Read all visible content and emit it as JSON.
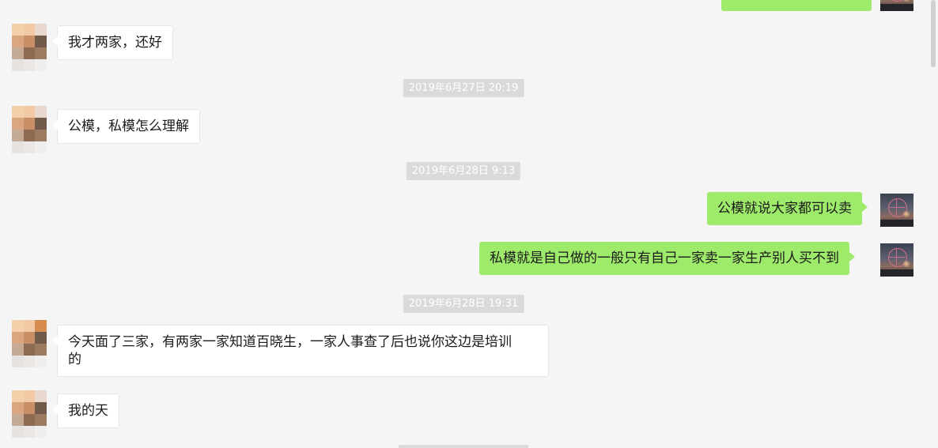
{
  "messages": {
    "partial_top_out": "",
    "m1": "我才两家，还好",
    "ts1": "2019年6月27日 20:19",
    "m2": "公模，私模怎么理解",
    "ts2": "2019年6月28日 9:13",
    "m3": "公模就说大家都可以卖",
    "m4": "私模就是自己做的一般只有自己一家卖一家生产别人买不到",
    "ts3": "2019年6月28日 19:31",
    "m5_line1": "今天面了三家，有两家一家知道百晓生，一家人事查了后也说你这边是培训",
    "m5_line2": "的",
    "m6": "我的天"
  },
  "colors": {
    "background": "#f5f5f5",
    "incoming_bubble": "#ffffff",
    "outgoing_bubble": "#9eea6a",
    "timestamp_bg": "#dadada"
  }
}
